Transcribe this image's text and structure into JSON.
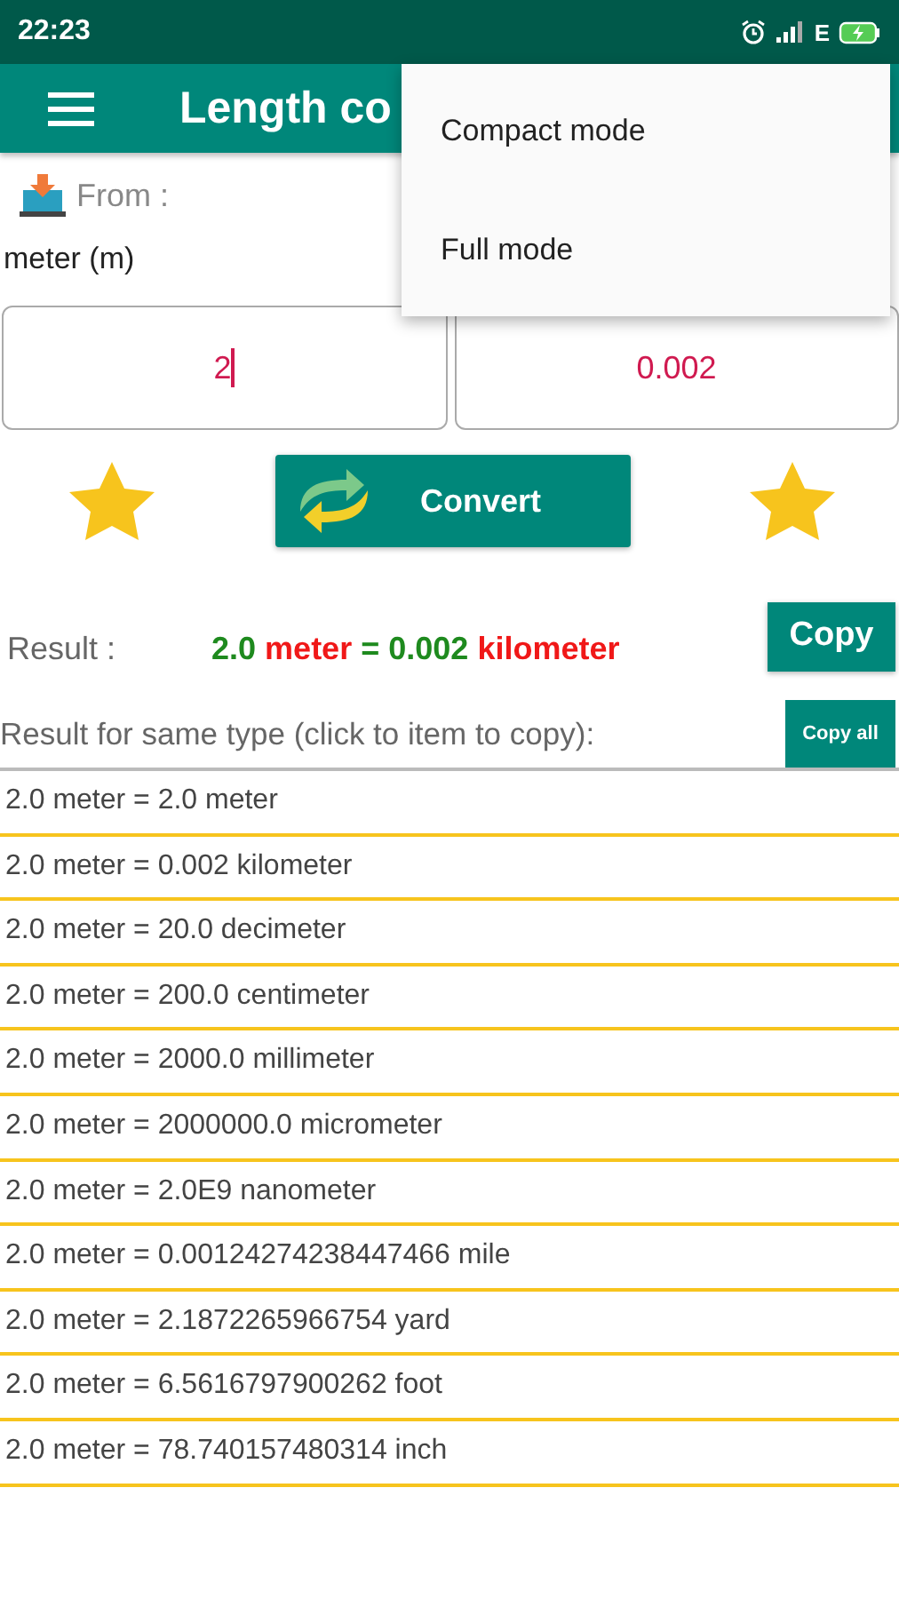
{
  "status_bar": {
    "time": "22:23",
    "network": "E"
  },
  "app_bar": {
    "title": "Length co"
  },
  "menu": {
    "items": [
      {
        "label": "Compact mode"
      },
      {
        "label": "Full mode"
      }
    ]
  },
  "from": {
    "label": "From :",
    "unit": "meter (m)"
  },
  "inputs": {
    "from_value": "2",
    "to_value": "0.002"
  },
  "convert_button": "Convert",
  "result": {
    "label": "Result :",
    "parts": [
      {
        "text": "2.0",
        "kind": "value"
      },
      {
        "text": "meter",
        "kind": "unit"
      },
      {
        "text": "=",
        "kind": "value"
      },
      {
        "text": "0.002",
        "kind": "value"
      },
      {
        "text": "kilometer",
        "kind": "unit"
      }
    ],
    "copy_button": "Copy"
  },
  "same_type": {
    "label": "Result for same type (click to item to copy):",
    "copy_all_button": "Copy all",
    "rows": [
      "2.0 meter = 2.0 meter",
      "2.0 meter = 0.002 kilometer",
      "2.0 meter = 20.0 decimeter",
      "2.0 meter = 200.0 centimeter",
      "2.0 meter = 2000.0 millimeter",
      "2.0 meter = 2000000.0 micrometer",
      "2.0 meter = 2.0E9 nanometer",
      "2.0 meter = 0.00124274238447466 mile",
      "2.0 meter = 2.1872265966754 yard",
      "2.0 meter = 6.5616797900262 foot",
      "2.0 meter = 78.740157480314 inch"
    ]
  }
}
